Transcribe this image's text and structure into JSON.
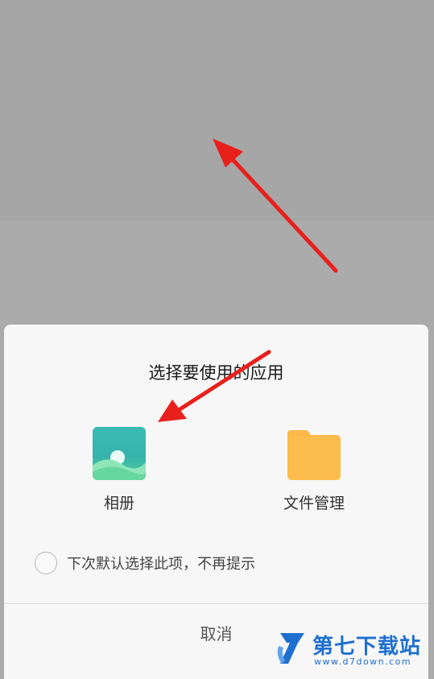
{
  "dialog": {
    "title": "选择要使用的应用",
    "apps": [
      {
        "label": "相册",
        "icon": "gallery-icon"
      },
      {
        "label": "文件管理",
        "icon": "folder-icon"
      }
    ],
    "default_option": {
      "label": "下次默认选择此项，不再提示",
      "checked": false
    },
    "cancel_label": "取消"
  },
  "watermark": {
    "brand": "第七下载站",
    "url": "www.d7down.com"
  },
  "colors": {
    "backdrop": "#ababab",
    "sheet": "#f7f7f7",
    "annotation_arrow": "#e8201c",
    "folder": "#fcb94a",
    "gallery": "#3bbbb4",
    "watermark": "#1e6fd0"
  }
}
